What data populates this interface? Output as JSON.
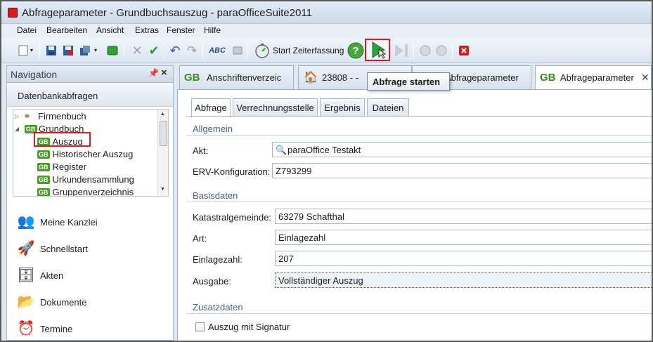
{
  "window": {
    "title": "Abfrageparameter - Grundbuchsauszug - paraOfficeSuite2011"
  },
  "menu": [
    "Datei",
    "Bearbeiten",
    "Ansicht",
    "Extras",
    "Fenster",
    "Hilfe"
  ],
  "toolbar": {
    "start_zeiterfassung": "Start Zeiterfassung",
    "tooltip": "Abfrage starten",
    "spellcheck_label": "ABC"
  },
  "navigation": {
    "title": "Navigation",
    "section": "Datenbankabfragen",
    "gb_badge": "GB",
    "tree": [
      {
        "label": "Firmenbuch"
      },
      {
        "label": "Grundbuch"
      },
      {
        "label": "Auszug"
      },
      {
        "label": "Historischer Auszug"
      },
      {
        "label": "Register"
      },
      {
        "label": "Urkundensammlung"
      },
      {
        "label": "Gruppenverzeichnis"
      }
    ],
    "buttons": [
      "Meine Kanzlei",
      "Schnellstart",
      "Akten",
      "Dokumente",
      "Termine"
    ]
  },
  "doc_tabs": [
    {
      "badge": "GB",
      "label": "Anschriftenverzeic"
    },
    {
      "label": "23808 -  -"
    },
    {
      "label": "Abfrageparameter"
    },
    {
      "badge": "GB",
      "label": "Abfrageparameter"
    }
  ],
  "form": {
    "tabs": [
      "Abfrage",
      "Verrechnungsstelle",
      "Ergebnis",
      "Dateien"
    ],
    "sections": {
      "allgemein": "Allgemein",
      "basisdaten": "Basisdaten",
      "zusatzdaten": "Zusatzdaten"
    },
    "fields": {
      "akt": {
        "label": "Akt:",
        "value": "paraOffice Testakt"
      },
      "erv": {
        "label": "ERV-Konfiguration:",
        "value": "Z793299"
      },
      "katastral": {
        "label": "Katastralgemeinde:",
        "value": "63279 Schafthal"
      },
      "art": {
        "label": "Art:",
        "value": "Einlagezahl"
      },
      "einlagezahl": {
        "label": "Einlagezahl:",
        "value": "207"
      },
      "ausgabe": {
        "label": "Ausgabe:",
        "value": "Vollständiger Auszug"
      }
    },
    "signatur": {
      "label": "Auszug mit Signatur",
      "checked": false
    }
  },
  "colors": {
    "accent_red": "#d61c1c",
    "gb_green": "#4a9b2a",
    "section_text": "#4b617c"
  }
}
